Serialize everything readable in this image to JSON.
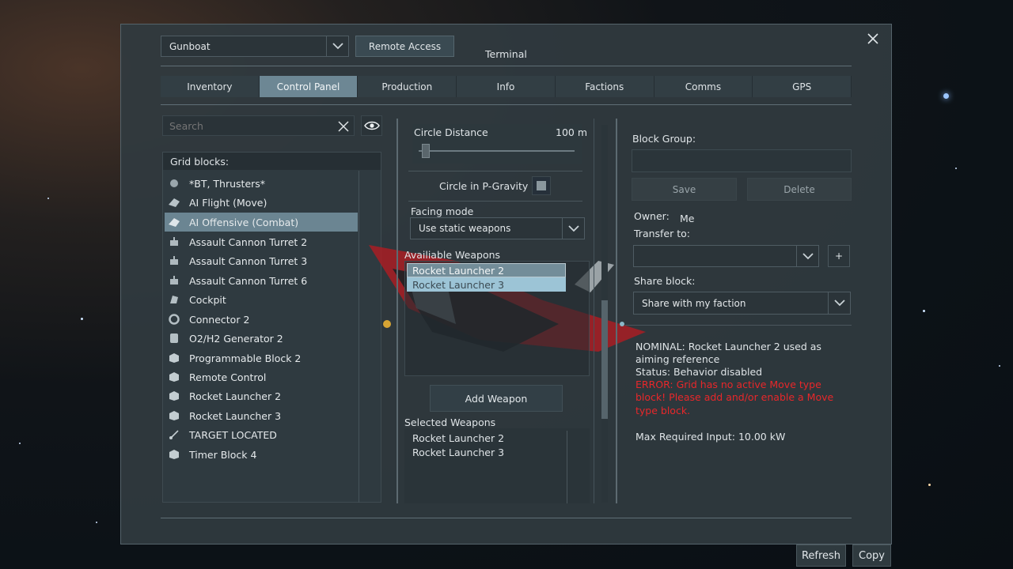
{
  "window": {
    "title": "Terminal",
    "close_icon": "close-icon"
  },
  "grid_selector": {
    "value": "Gunboat"
  },
  "remote_access_label": "Remote Access",
  "tabs": [
    {
      "label": "Inventory",
      "active": false
    },
    {
      "label": "Control Panel",
      "active": true
    },
    {
      "label": "Production",
      "active": false
    },
    {
      "label": "Info",
      "active": false
    },
    {
      "label": "Factions",
      "active": false
    },
    {
      "label": "Comms",
      "active": false
    },
    {
      "label": "GPS",
      "active": false
    }
  ],
  "search": {
    "placeholder": "Search"
  },
  "blocks": {
    "header": "Grid blocks:",
    "items": [
      {
        "label": "*BT, Thrusters*",
        "icon": "group-icon"
      },
      {
        "label": "AI Flight (Move)",
        "icon": "ai-flight-icon"
      },
      {
        "label": "AI Offensive (Combat)",
        "icon": "ai-offensive-icon",
        "selected": true
      },
      {
        "label": "Assault Cannon Turret 2",
        "icon": "turret-icon"
      },
      {
        "label": "Assault Cannon Turret 3",
        "icon": "turret-icon"
      },
      {
        "label": "Assault Cannon Turret 6",
        "icon": "turret-icon"
      },
      {
        "label": "Cockpit",
        "icon": "cockpit-icon"
      },
      {
        "label": "Connector 2",
        "icon": "connector-icon"
      },
      {
        "label": "O2/H2 Generator 2",
        "icon": "generator-icon"
      },
      {
        "label": "Programmable Block 2",
        "icon": "programmable-block-icon"
      },
      {
        "label": "Remote Control",
        "icon": "remote-control-icon"
      },
      {
        "label": "Rocket Launcher 2",
        "icon": "rocket-launcher-icon"
      },
      {
        "label": "Rocket Launcher 3",
        "icon": "rocket-launcher-icon"
      },
      {
        "label": "TARGET LOCATED",
        "icon": "antenna-icon"
      },
      {
        "label": "Timer Block 4",
        "icon": "timer-block-icon"
      }
    ]
  },
  "controls": {
    "circle_distance": {
      "label": "Circle Distance",
      "value": "100 m"
    },
    "circle_gravity": {
      "label": "Circle in P-Gravity",
      "checked": false
    },
    "facing_mode": {
      "label": "Facing mode",
      "value": "Use static weapons"
    },
    "available_weapons": {
      "label": "Availiable Weapons",
      "items": [
        "Rocket Launcher 2",
        "Rocket Launcher 3"
      ]
    },
    "add_weapon_label": "Add Weapon",
    "selected_weapons": {
      "label": "Selected Weapons",
      "items": [
        "Rocket Launcher 2",
        "Rocket Launcher 3"
      ]
    }
  },
  "info": {
    "block_group_label": "Block Group:",
    "save_label": "Save",
    "delete_label": "Delete",
    "owner_label": "Owner:",
    "owner_value": "Me",
    "transfer_label": "Transfer to:",
    "add_label": "+",
    "share_label": "Share block:",
    "share_value": "Share with my faction",
    "status_lines": [
      "NOMINAL: Rocket Launcher 2 used as",
      "aiming reference",
      "Status: Behavior disabled"
    ],
    "error_lines": [
      "ERROR: Grid has no active Move type",
      "block! Please add and/or enable a Move",
      "type block."
    ],
    "max_input": "Max Required Input: 10.00 kW"
  },
  "footer": {
    "refresh_label": "Refresh",
    "copy_label": "Copy"
  },
  "colors": {
    "accent": "#6b8592",
    "error": "#e8272a",
    "panel": "#303b41"
  }
}
